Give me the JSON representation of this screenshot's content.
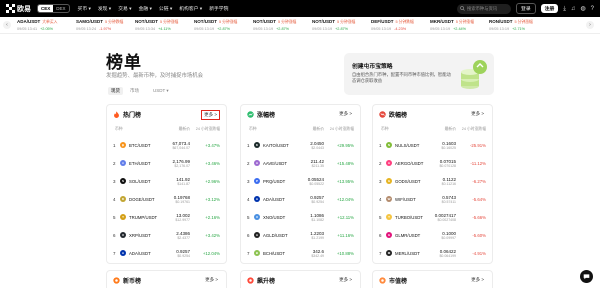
{
  "nav": {
    "logo_text": "欧易",
    "seg_options": [
      "CEX",
      "DEX"
    ],
    "menu": [
      "买币 ▾",
      "发现 ▾",
      "交易 ▾",
      "金融 ▾",
      "公链 ▾",
      "机构客户 ▾",
      "新手学院"
    ],
    "search_placeholder": "搜索币种与资讯",
    "login": "登录",
    "signup": "注册"
  },
  "ticker": [
    {
      "pair": "ADA/USDT",
      "tag": "大单买入",
      "time": "09/05 13:41",
      "change": "+2.05%",
      "dir": "up"
    },
    {
      "pair": "SAMO/USDT",
      "tag": "5 分钟跌幅",
      "time": "09/05 13:24",
      "change": "-1.97%",
      "dir": "down"
    },
    {
      "pair": "NOT/USDT",
      "tag": "5 分钟涨幅",
      "time": "09/05 13:34",
      "change": "+4.11%",
      "dir": "up"
    },
    {
      "pair": "NOT/USDT",
      "tag": "5 分钟涨幅",
      "time": "09/05 13:19",
      "change": "+2.87%",
      "dir": "up"
    },
    {
      "pair": "NOT/USDT",
      "tag": "5 分钟涨幅",
      "time": "09/05 13:19",
      "change": "+2.87%",
      "dir": "up"
    },
    {
      "pair": "NOT/USDT",
      "tag": "5 分钟涨幅",
      "time": "09/05 13:19",
      "change": "+2.87%",
      "dir": "up"
    },
    {
      "pair": "DEF/USDT",
      "tag": "5 分钟跌幅",
      "time": "09/05 13:19",
      "change": "-4.23%",
      "dir": "down"
    },
    {
      "pair": "MKR/USDT",
      "tag": "5 分钟涨幅",
      "time": "09/05 13:19",
      "change": "+2.44%",
      "dir": "up"
    },
    {
      "pair": "RON/USDT",
      "tag": "5 分钟涨幅",
      "time": "09/05 13:19",
      "change": "+2.71%",
      "dir": "up"
    }
  ],
  "header": {
    "title": "榜单",
    "subtitle": "发掘趋势、最新币种，及时捕捉市场机会"
  },
  "promo": {
    "title": "创建屯币宝策略",
    "desc": "自由组合热门币种，配置不同币种市值比例，智能动态调仓获取收益"
  },
  "tabs": [
    "现货",
    "市场",
    "USDT ▾"
  ],
  "categories": [
    "概况",
    "行情"
  ],
  "columns": {
    "pair": "币种",
    "price": "最新价",
    "change": "24 小时涨跌幅"
  },
  "more_label": "更多 >",
  "cards": [
    {
      "title": "热门榜",
      "rows": [
        {
          "rank": "1",
          "pair": "BTC/USDT",
          "price": "67,073.4",
          "sub": "$67,044.07",
          "change": "+3.47%",
          "dir": "up",
          "color": "#f7931a",
          "glyph": "₿"
        },
        {
          "rank": "2",
          "pair": "ETH/USDT",
          "price": "2,176.99",
          "sub": "$2,176.07",
          "change": "+3.46%",
          "dir": "up",
          "color": "#627eea",
          "glyph": "Ξ"
        },
        {
          "rank": "3",
          "pair": "SOL/USDT",
          "price": "141.92",
          "sub": "$141.87",
          "change": "+2.96%",
          "dir": "up",
          "color": "#111111",
          "glyph": "S"
        },
        {
          "rank": "4",
          "pair": "DOGE/USDT",
          "price": "0.19768",
          "sub": "$0.19761",
          "change": "+3.12%",
          "dir": "up",
          "color": "#c2a633",
          "glyph": "D"
        },
        {
          "rank": "5",
          "pair": "TRUMP/USDT",
          "price": "13.002",
          "sub": "$12.9977",
          "change": "+2.16%",
          "dir": "up",
          "color": "#d4a017",
          "glyph": "T"
        },
        {
          "rank": "6",
          "pair": "XRP/USDT",
          "price": "2.4386",
          "sub": "$2.4377",
          "change": "+3.42%",
          "dir": "up",
          "color": "#23292f",
          "glyph": "X"
        },
        {
          "rank": "7",
          "pair": "ADA/USDT",
          "price": "0.9257",
          "sub": "$0.9254",
          "change": "+12.04%",
          "dir": "up",
          "color": "#0033ad",
          "glyph": "A"
        }
      ]
    },
    {
      "title": "涨幅榜",
      "rows": [
        {
          "rank": "1",
          "pair": "KAITO/USDT",
          "price": "2.0450",
          "sub": "$2.0443",
          "change": "+29.95%",
          "dir": "up",
          "color": "#1b2a2a",
          "glyph": "K"
        },
        {
          "rank": "2",
          "pair": "AAVE/USDT",
          "price": "211.42",
          "sub": "$211.35",
          "change": "+15.48%",
          "dir": "up",
          "color": "#9d6ad1",
          "glyph": "A"
        },
        {
          "rank": "3",
          "pair": "PRQ/USDT",
          "price": "0.05524",
          "sub": "$0.05522",
          "change": "+13.95%",
          "dir": "up",
          "color": "#3b6df0",
          "glyph": "P"
        },
        {
          "rank": "4",
          "pair": "ADA/USDT",
          "price": "0.9257",
          "sub": "$0.9254",
          "change": "+12.04%",
          "dir": "up",
          "color": "#0033ad",
          "glyph": "A"
        },
        {
          "rank": "5",
          "pair": "XNO/USDT",
          "price": "1.1086",
          "sub": "$1.1082",
          "change": "+12.11%",
          "dir": "up",
          "color": "#4a90e2",
          "glyph": "X"
        },
        {
          "rank": "6",
          "pair": "AGLD/USDT",
          "price": "1.2203",
          "sub": "$1.2199",
          "change": "+11.16%",
          "dir": "up",
          "color": "#222222",
          "glyph": "A"
        },
        {
          "rank": "7",
          "pair": "BCH/USDT",
          "price": "342.6",
          "sub": "$342.49",
          "change": "+10.88%",
          "dir": "up",
          "color": "#8dc351",
          "glyph": "B"
        }
      ]
    },
    {
      "title": "跌幅榜",
      "rows": [
        {
          "rank": "1",
          "pair": "NULS/USDT",
          "price": "0.1603",
          "sub": "$0.16025",
          "change": "-25.91%",
          "dir": "down",
          "color": "#82bd39",
          "glyph": "N"
        },
        {
          "rank": "2",
          "pair": "AERGO/USDT",
          "price": "0.07015",
          "sub": "$0.070128",
          "change": "-11.12%",
          "dir": "down",
          "color": "#ff3f7f",
          "glyph": "A"
        },
        {
          "rank": "3",
          "pair": "GODS/USDT",
          "price": "0.1122",
          "sub": "$0.11216",
          "change": "-6.27%",
          "dir": "down",
          "color": "#e6b422",
          "glyph": "G"
        },
        {
          "rank": "4",
          "pair": "WIF/USDT",
          "price": "0.5743",
          "sub": "$0.57411",
          "change": "-5.64%",
          "dir": "down",
          "color": "#b38b6d",
          "glyph": "W"
        },
        {
          "rank": "5",
          "pair": "TURBO/USDT",
          "price": "0.0027417",
          "sub": "$0.0027408",
          "change": "-5.66%",
          "dir": "down",
          "color": "#f5c542",
          "glyph": "T"
        },
        {
          "rank": "6",
          "pair": "GLMR/USDT",
          "price": "0.1000",
          "sub": "$0.09997",
          "change": "-5.60%",
          "dir": "down",
          "color": "#e1147b",
          "glyph": "G"
        },
        {
          "rank": "7",
          "pair": "MERL/USDT",
          "price": "0.06422",
          "sub": "$0.064199",
          "change": "-4.91%",
          "dir": "down",
          "color": "#222222",
          "glyph": "M"
        }
      ]
    }
  ],
  "bottom_cards": [
    {
      "title": "新币榜"
    },
    {
      "title": "飙升榜"
    },
    {
      "title": "市值榜"
    }
  ],
  "colors": {
    "up": "#28a745",
    "down": "#e5483c",
    "hot_icon": "#ff5a1f",
    "gain_icon": "#2dbd6e",
    "loss_icon": "#e5483c",
    "highlight_border": "#e0261b"
  }
}
